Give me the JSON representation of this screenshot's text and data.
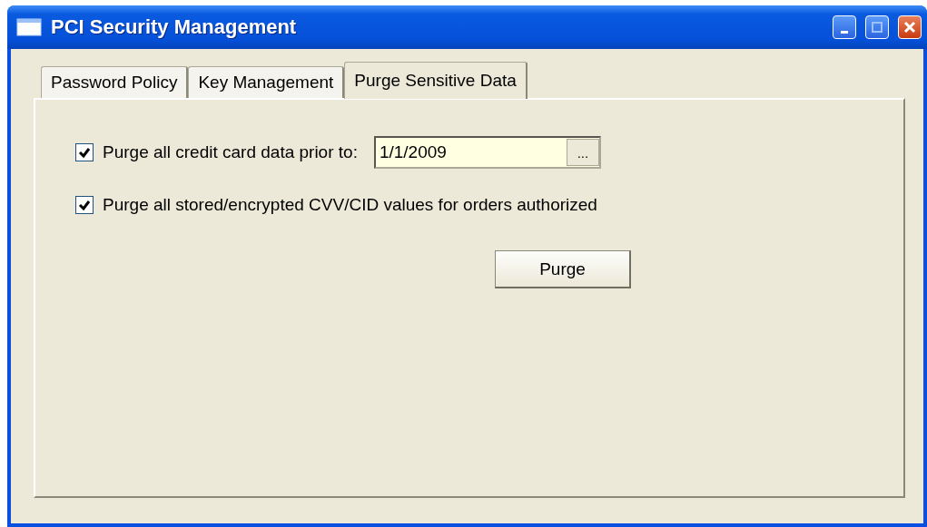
{
  "window": {
    "title": "PCI Security Management"
  },
  "tabs": [
    {
      "label": "Password Policy",
      "selected": false
    },
    {
      "label": "Key Management",
      "selected": false
    },
    {
      "label": "Purge Sensitive Data",
      "selected": true
    }
  ],
  "options": [
    {
      "label": "Purge all credit card data prior to:",
      "checked": true,
      "date": "1/1/2009",
      "browse": "..."
    },
    {
      "label": "Purge all stored/encrypted CVV/CID values for orders authorized",
      "checked": true
    }
  ],
  "purge_button": "Purge"
}
